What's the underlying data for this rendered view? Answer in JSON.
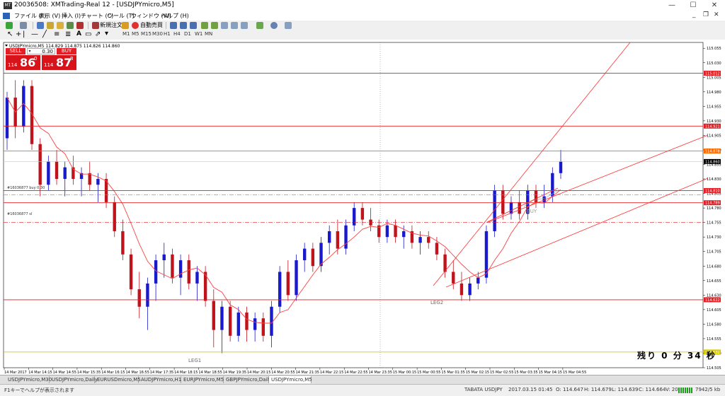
{
  "window": {
    "title": "20036508: XMTrading-Real 12 - [USDJPYmicro,M5]",
    "app_icon": "mt4-icon"
  },
  "menu": {
    "items": [
      "ファイル (F)",
      "表示 (V)",
      "挿入 (I)",
      "チャート (C)",
      "ツール (T)",
      "ウィンドウ (W)",
      "ヘルプ (H)"
    ]
  },
  "toolbar": {
    "new_order": "新規注文",
    "auto_trading": "自動売買"
  },
  "timeframes": [
    "M1",
    "M5",
    "M15",
    "M30",
    "H1",
    "H4",
    "D1",
    "W1",
    "MN"
  ],
  "chart": {
    "info": "USDJPYmicro,M5  114.829 114.875 114.826 114.860",
    "price_ticks": [
      "115.055",
      "115.030",
      "115.005",
      "114.980",
      "114.955",
      "114.930",
      "114.905",
      "114.880",
      "114.855",
      "114.830",
      "114.805",
      "114.780",
      "114.755",
      "114.730",
      "114.705",
      "114.680",
      "114.655",
      "114.630",
      "114.605",
      "114.580",
      "114.555",
      "114.530",
      "114.505"
    ],
    "time_ticks": [
      "14 Mar 2017",
      "14 Mar 14:15",
      "14 Mar 14:55",
      "14 Mar 15:35",
      "14 Mar 16:15",
      "14 Mar 16:55",
      "14 Mar 17:35",
      "14 Mar 18:15",
      "14 Mar 18:55",
      "14 Mar 19:35",
      "14 Mar 20:15",
      "14 Mar 20:55",
      "14 Mar 21:35",
      "14 Mar 22:15",
      "14 Mar 22:55",
      "14 Mar 23:35",
      "15 Mar 00:15",
      "15 Mar 00:55",
      "15 Mar 01:35",
      "15 Mar 02:15",
      "15 Mar 02:55",
      "15 Mar 03:35",
      "15 Mar 04:15",
      "15 Mar 04:55"
    ],
    "level_labels": [
      {
        "price": "115.012",
        "color": "#e31e24"
      },
      {
        "price": "114.921",
        "color": "#e31e24"
      },
      {
        "price": "114.878",
        "color": "#ff6a00"
      },
      {
        "price": "114.860",
        "color": "#000000"
      },
      {
        "price": "114.810",
        "color": "#e31e24"
      },
      {
        "price": "114.789",
        "color": "#e31e24"
      },
      {
        "price": "114.622",
        "color": "#e31e24"
      },
      {
        "price": "114.532",
        "color": "#d6c800"
      }
    ],
    "order_labels": [
      "#16036877 buy 0.30",
      "#16036877 sl"
    ],
    "annotations": {
      "leg1": "LEG1",
      "leg2": "LEG2",
      "buy": "BUY"
    },
    "timer": "残り 0 分 34 秒"
  },
  "one_click": {
    "sell": "SELL",
    "buy": "BUY",
    "lot": "0.30",
    "sell_small": "114",
    "sell_big": "86",
    "sell_sup": "0",
    "buy_small": "114",
    "buy_big": "87",
    "buy_sup": "8"
  },
  "tabs": [
    "USDJPYmicro,M30",
    "USDJPYmicro,Daily",
    "EURUSDmicro,M5",
    "AUDJPYmicro,H1",
    "EURJPYmicro,M5",
    "GBPJPYmicro,Daily",
    "USDJPYmicro,M5"
  ],
  "status": {
    "help": "F1キーでヘルプが表示されます",
    "profile": "TABATA USDJPY",
    "datetime": "2017.03.15 01:45",
    "open": "O: 114.647",
    "high": "H: 114.679",
    "low": "L: 114.639",
    "close": "C: 114.664",
    "volume": "V: 208",
    "traffic": "7942/5 kb"
  },
  "colors": {
    "bull": "#1a1acd",
    "bear": "#c0141c",
    "ma": "#ff4040",
    "level": "#e31e24",
    "grid": "#d0d0d0"
  },
  "chart_data": {
    "type": "candlestick",
    "price_range": [
      114.505,
      115.065
    ],
    "candles": [
      [
        114.9,
        114.98,
        114.88,
        114.97
      ],
      [
        114.97,
        115.0,
        114.9,
        114.92
      ],
      [
        114.92,
        115.0,
        114.91,
        114.99
      ],
      [
        114.99,
        115.0,
        114.88,
        114.89
      ],
      [
        114.89,
        114.9,
        114.8,
        114.82
      ],
      [
        114.82,
        114.87,
        114.81,
        114.86
      ],
      [
        114.86,
        114.88,
        114.82,
        114.83
      ],
      [
        114.83,
        114.86,
        114.8,
        114.85
      ],
      [
        114.85,
        114.87,
        114.82,
        114.83
      ],
      [
        114.83,
        114.85,
        114.8,
        114.84
      ],
      [
        114.84,
        114.86,
        114.81,
        114.82
      ],
      [
        114.82,
        114.84,
        114.79,
        114.83
      ],
      [
        114.83,
        114.84,
        114.78,
        114.79
      ],
      [
        114.79,
        114.8,
        114.73,
        114.74
      ],
      [
        114.74,
        114.76,
        114.69,
        114.7
      ],
      [
        114.7,
        114.71,
        114.63,
        114.64
      ],
      [
        114.64,
        114.67,
        114.59,
        114.61
      ],
      [
        114.61,
        114.66,
        114.57,
        114.65
      ],
      [
        114.65,
        114.7,
        114.62,
        114.69
      ],
      [
        114.69,
        114.72,
        114.66,
        114.7
      ],
      [
        114.7,
        114.71,
        114.65,
        114.66
      ],
      [
        114.66,
        114.7,
        114.63,
        114.69
      ],
      [
        114.69,
        114.7,
        114.64,
        114.65
      ],
      [
        114.65,
        114.68,
        114.62,
        114.67
      ],
      [
        114.67,
        114.68,
        114.61,
        114.62
      ],
      [
        114.62,
        114.64,
        114.54,
        114.57
      ],
      [
        114.57,
        114.62,
        114.53,
        114.61
      ],
      [
        114.61,
        114.62,
        114.55,
        114.56
      ],
      [
        114.56,
        114.61,
        114.55,
        114.6
      ],
      [
        114.6,
        114.61,
        114.55,
        114.57
      ],
      [
        114.57,
        114.6,
        114.55,
        114.59
      ],
      [
        114.59,
        114.6,
        114.55,
        114.56
      ],
      [
        114.56,
        114.62,
        114.54,
        114.61
      ],
      [
        114.61,
        114.68,
        114.6,
        114.67
      ],
      [
        114.67,
        114.69,
        114.62,
        114.63
      ],
      [
        114.63,
        114.7,
        114.62,
        114.69
      ],
      [
        114.69,
        114.72,
        114.67,
        114.71
      ],
      [
        114.71,
        114.72,
        114.67,
        114.68
      ],
      [
        114.68,
        114.73,
        114.67,
        114.72
      ],
      [
        114.72,
        114.75,
        114.7,
        114.74
      ],
      [
        114.74,
        114.76,
        114.7,
        114.71
      ],
      [
        114.71,
        114.76,
        114.7,
        114.75
      ],
      [
        114.75,
        114.79,
        114.74,
        114.78
      ],
      [
        114.78,
        114.79,
        114.75,
        114.76
      ],
      [
        114.76,
        114.78,
        114.74,
        114.75
      ],
      [
        114.75,
        114.76,
        114.72,
        114.73
      ],
      [
        114.73,
        114.76,
        114.72,
        114.75
      ],
      [
        114.75,
        114.76,
        114.72,
        114.73
      ],
      [
        114.73,
        114.75,
        114.71,
        114.74
      ],
      [
        114.74,
        114.75,
        114.71,
        114.72
      ],
      [
        114.72,
        114.74,
        114.7,
        114.73
      ],
      [
        114.73,
        114.74,
        114.71,
        114.72
      ],
      [
        114.72,
        114.73,
        114.69,
        114.7
      ],
      [
        114.7,
        114.71,
        114.66,
        114.67
      ],
      [
        114.67,
        114.69,
        114.64,
        114.65
      ],
      [
        114.65,
        114.67,
        114.62,
        114.63
      ],
      [
        114.63,
        114.66,
        114.62,
        114.65
      ],
      [
        114.65,
        114.67,
        114.64,
        114.66
      ],
      [
        114.66,
        114.75,
        114.65,
        114.74
      ],
      [
        114.74,
        114.82,
        114.73,
        114.81
      ],
      [
        114.81,
        114.82,
        114.76,
        114.77
      ],
      [
        114.77,
        114.8,
        114.76,
        114.79
      ],
      [
        114.79,
        114.81,
        114.76,
        114.77
      ],
      [
        114.77,
        114.82,
        114.76,
        114.81
      ],
      [
        114.81,
        114.82,
        114.78,
        114.79
      ],
      [
        114.79,
        114.82,
        114.78,
        114.8
      ],
      [
        114.8,
        114.85,
        114.79,
        114.84
      ],
      [
        114.84,
        114.88,
        114.83,
        114.86
      ]
    ]
  }
}
